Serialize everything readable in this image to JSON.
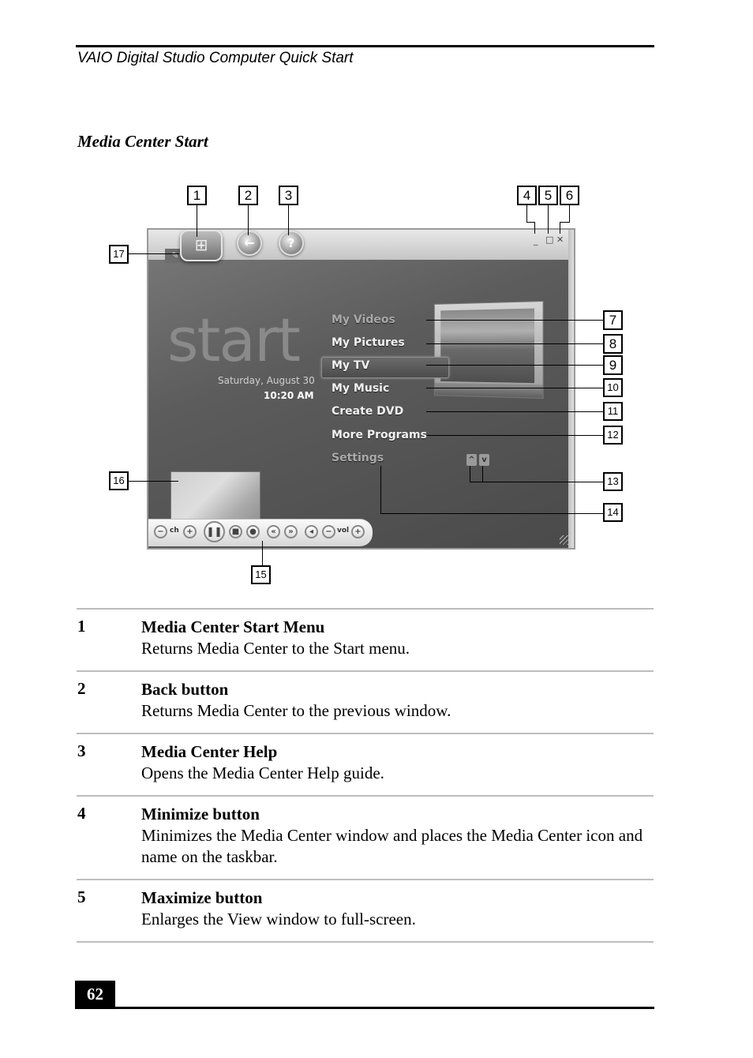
{
  "header": {
    "running_head": "VAIO Digital Studio Computer Quick Start",
    "section_title": "Media Center Start"
  },
  "figure": {
    "callouts": [
      "1",
      "2",
      "3",
      "4",
      "5",
      "6",
      "7",
      "8",
      "9",
      "10",
      "11",
      "12",
      "13",
      "14",
      "15",
      "16",
      "17"
    ],
    "window": {
      "start_word": "start",
      "date": "Saturday, August 30",
      "time": "10:20 AM",
      "menu": [
        {
          "label": "My Videos",
          "state": "dim"
        },
        {
          "label": "My Pictures",
          "state": "normal"
        },
        {
          "label": "My TV",
          "state": "selected"
        },
        {
          "label": "My Music",
          "state": "normal"
        },
        {
          "label": "Create DVD",
          "state": "normal"
        },
        {
          "label": "More Programs",
          "state": "normal"
        },
        {
          "label": "Settings",
          "state": "dim"
        }
      ],
      "icons": {
        "start": "windows-logo-icon",
        "back": "back-arrow-icon",
        "help": "help-icon",
        "minimize": "minimize-icon",
        "maximize": "maximize-icon",
        "close": "close-icon",
        "scroll_up": "chevron-up-icon",
        "scroll_down": "chevron-down-icon",
        "pencil": "pencil-icon"
      },
      "transport": {
        "ch_label": "ch",
        "vol_label": "vol"
      }
    }
  },
  "legend": [
    {
      "num": "1",
      "title": "Media Center Start Menu",
      "desc": "Returns Media Center to the Start menu."
    },
    {
      "num": "2",
      "title": "Back button",
      "desc": "Returns Media Center to the previous window."
    },
    {
      "num": "3",
      "title": "Media Center Help",
      "desc": "Opens the Media Center Help guide."
    },
    {
      "num": "4",
      "title": "Minimize button",
      "desc": "Minimizes the Media Center window and places the Media Center icon and name on the taskbar."
    },
    {
      "num": "5",
      "title": "Maximize button",
      "desc": "Enlarges the View window to full-screen."
    }
  ],
  "footer": {
    "page_number": "62"
  }
}
